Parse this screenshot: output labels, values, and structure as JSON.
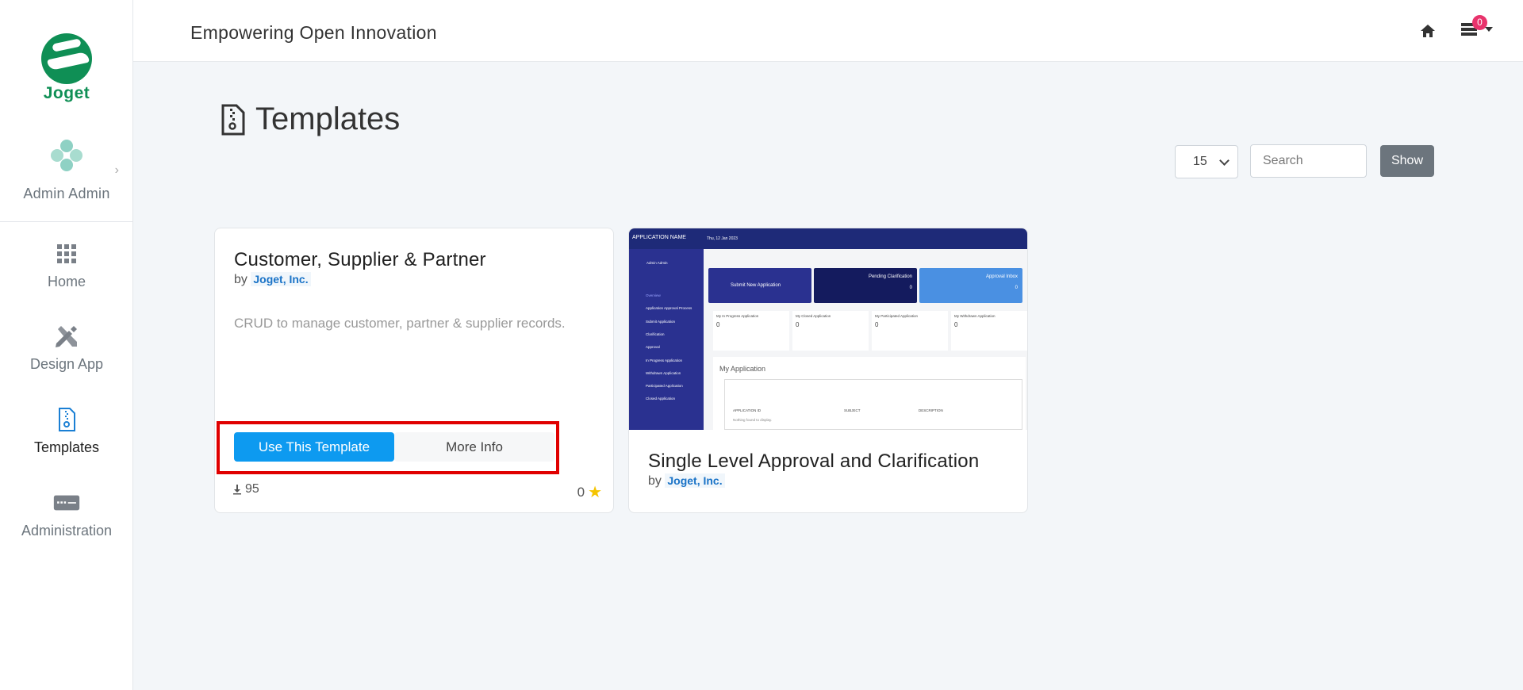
{
  "sidebar": {
    "logo_text": "Joget",
    "user_name": "Admin Admin",
    "items": [
      {
        "label": "Home",
        "icon": "grid-icon"
      },
      {
        "label": "Design App",
        "icon": "design-tools-icon"
      },
      {
        "label": "Templates",
        "icon": "file-zipper-icon",
        "active": true
      },
      {
        "label": "Administration",
        "icon": "server-icon"
      }
    ]
  },
  "topbar": {
    "title": "Empowering Open Innovation",
    "notification_count": "0"
  },
  "page": {
    "title": "Templates",
    "per_page": "15",
    "search_placeholder": "Search",
    "show_label": "Show"
  },
  "cards": [
    {
      "title": "Customer, Supplier & Partner",
      "by_prefix": "by",
      "vendor": "Joget, Inc.",
      "description": "CRUD to manage customer, partner & supplier records.",
      "use_label": "Use This Template",
      "info_label": "More Info",
      "downloads": "95",
      "rating": "0"
    },
    {
      "title": "Single Level Approval and Clarification",
      "by_prefix": "by",
      "vendor": "Joget, Inc.",
      "preview": {
        "app_name": "APPLICATION NAME",
        "date": "Thu, 12 Jan 2023",
        "user": "Admin Admin",
        "menu": [
          "Overview",
          "Application Approval Process",
          "Submit Application",
          "Clarification",
          "Approval",
          "In Progress Application",
          "Withdrawn Application",
          "Participated Application",
          "Closed Application"
        ],
        "tiles": [
          "Submit New Application",
          "Pending Clarification",
          "Approval Inbox"
        ],
        "tile_counts": [
          "0",
          "0"
        ],
        "stats": [
          "My In Progress Application",
          "My Closed Application",
          "My Participated Application",
          "My Withdrawn Application"
        ],
        "stat_values": [
          "0",
          "0",
          "0",
          "0"
        ],
        "panel_title": "My Application",
        "columns": [
          "APPLICATION ID",
          "SUBJECT",
          "DESCRIPTION"
        ],
        "empty_text": "Nothing found to display."
      }
    }
  ],
  "colors": {
    "brand": "#0f8f55",
    "primary": "#0d9af0",
    "highlight": "#e00000",
    "badge": "#e8336c"
  }
}
